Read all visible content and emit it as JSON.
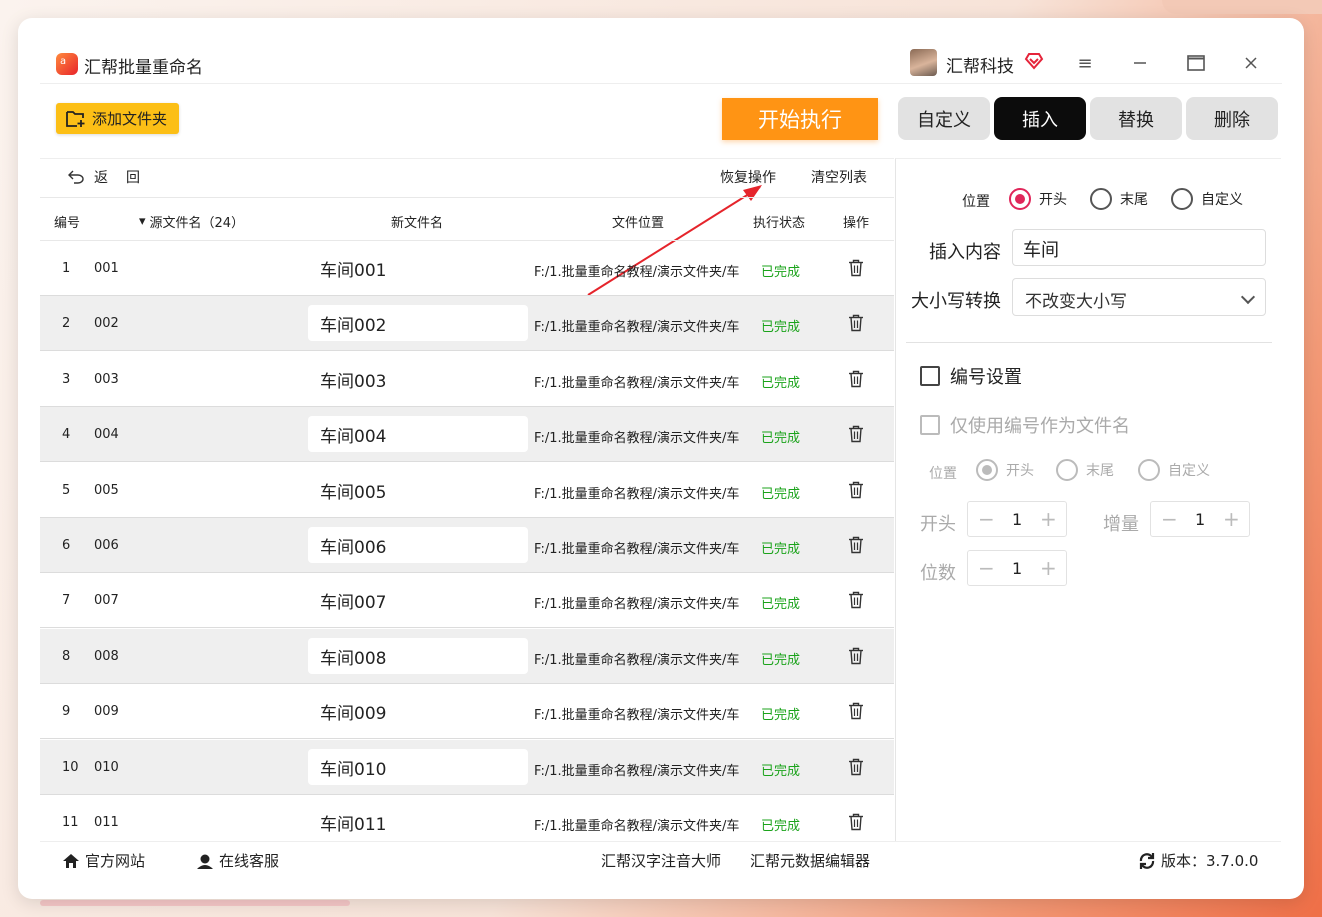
{
  "app": {
    "title": "汇帮批量重命名",
    "user_name": "汇帮科技"
  },
  "toolbar": {
    "add_folder": "添加文件夹",
    "start": "开始执行"
  },
  "mode_tabs": [
    {
      "label": "自定义",
      "active": false
    },
    {
      "label": "插入",
      "active": true
    },
    {
      "label": "替换",
      "active": false
    },
    {
      "label": "删除",
      "active": false
    }
  ],
  "list_actions": {
    "back": "返",
    "back2": "回",
    "undo": "恢复操作",
    "clear": "清空列表"
  },
  "table": {
    "headers": {
      "index": "编号",
      "source": "源文件名（24）",
      "new_name": "新文件名",
      "location": "文件位置",
      "status": "执行状态",
      "action": "操作"
    },
    "rows": [
      {
        "idx": "1",
        "src": "001",
        "new": "车间001",
        "path": "F:/1.批量重命名教程/演示文件夹/车",
        "status": "已完成"
      },
      {
        "idx": "2",
        "src": "002",
        "new": "车间002",
        "path": "F:/1.批量重命名教程/演示文件夹/车",
        "status": "已完成"
      },
      {
        "idx": "3",
        "src": "003",
        "new": "车间003",
        "path": "F:/1.批量重命名教程/演示文件夹/车",
        "status": "已完成"
      },
      {
        "idx": "4",
        "src": "004",
        "new": "车间004",
        "path": "F:/1.批量重命名教程/演示文件夹/车",
        "status": "已完成"
      },
      {
        "idx": "5",
        "src": "005",
        "new": "车间005",
        "path": "F:/1.批量重命名教程/演示文件夹/车",
        "status": "已完成"
      },
      {
        "idx": "6",
        "src": "006",
        "new": "车间006",
        "path": "F:/1.批量重命名教程/演示文件夹/车",
        "status": "已完成"
      },
      {
        "idx": "7",
        "src": "007",
        "new": "车间007",
        "path": "F:/1.批量重命名教程/演示文件夹/车",
        "status": "已完成"
      },
      {
        "idx": "8",
        "src": "008",
        "new": "车间008",
        "path": "F:/1.批量重命名教程/演示文件夹/车",
        "status": "已完成"
      },
      {
        "idx": "9",
        "src": "009",
        "new": "车间009",
        "path": "F:/1.批量重命名教程/演示文件夹/车",
        "status": "已完成"
      },
      {
        "idx": "10",
        "src": "010",
        "new": "车间010",
        "path": "F:/1.批量重命名教程/演示文件夹/车",
        "status": "已完成"
      },
      {
        "idx": "11",
        "src": "011",
        "new": "车间011",
        "path": "F:/1.批量重命名教程/演示文件夹/车",
        "status": "已完成"
      }
    ]
  },
  "panel": {
    "position_label": "位置",
    "position_options": [
      "开头",
      "末尾",
      "自定义"
    ],
    "position_selected": "开头",
    "insert_label": "插入内容",
    "insert_value": "车间",
    "case_label": "大小写转换",
    "case_value": "不改变大小写",
    "numbering_label": "编号设置",
    "numbering_only_label": "仅使用编号作为文件名",
    "num_position_label": "位置",
    "num_position_options": [
      "开头",
      "末尾",
      "自定义"
    ],
    "start_label": "开头",
    "start_value": "1",
    "step_label": "增量",
    "step_value": "1",
    "digits_label": "位数",
    "digits_value": "1"
  },
  "footer": {
    "website": "官方网站",
    "support": "在线客服",
    "tool1": "汇帮汉字注音大师",
    "tool2": "汇帮元数据编辑器",
    "version_label": "版本：3.7.0.0"
  },
  "colors": {
    "accent_orange": "#ff9414",
    "folder_yellow": "#fcbf16",
    "status_green": "#1ba31b",
    "radio_red": "#e0265a",
    "active_tab": "#0c0c0c"
  }
}
